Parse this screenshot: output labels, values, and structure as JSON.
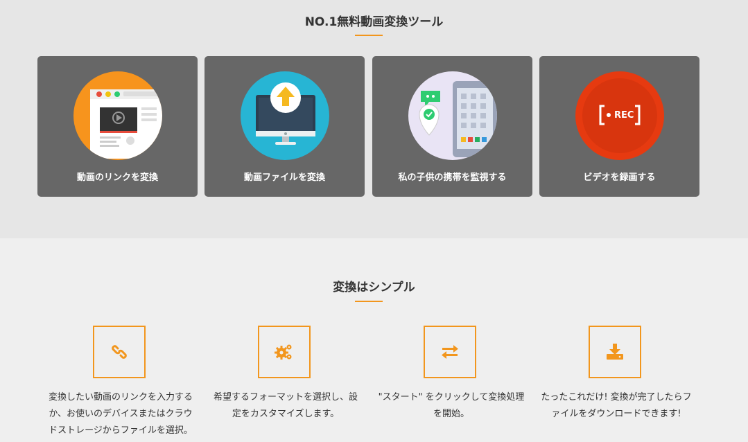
{
  "top_section": {
    "title": "NO.1無料動画変換ツール",
    "cards": [
      {
        "label": "動画のリンクを変換",
        "icon": "browser-video-icon"
      },
      {
        "label": "動画ファイルを変換",
        "icon": "monitor-upload-icon"
      },
      {
        "label": "私の子供の携帯を監視する",
        "icon": "phone-monitor-icon"
      },
      {
        "label": "ビデオを録画する",
        "icon": "rec-icon",
        "rec_text": "REC"
      }
    ]
  },
  "bottom_section": {
    "title": "変換はシンプル",
    "steps": [
      {
        "icon": "link-icon",
        "lines": [
          "変換したい動画のリンクを入力する",
          "か、お使いのデバイスまたはクラウ",
          "ドストレージからファイルを選択。"
        ]
      },
      {
        "icon": "gears-icon",
        "lines": [
          "希望するフォーマットを選択し、設",
          "定をカスタマイズします。"
        ]
      },
      {
        "icon": "swap-arrows-icon",
        "lines": [
          "\"スタート\" をクリックして変換処理",
          "を開始。"
        ]
      },
      {
        "icon": "download-icon",
        "lines": [
          "たったこれだけ! 変換が完了したらフ",
          "ァイルをダウンロードできます!"
        ]
      }
    ]
  },
  "colors": {
    "accent": "#f2961d",
    "card_bg": "#676767",
    "top_bg": "#e6e6e6",
    "bottom_bg": "#efefef"
  }
}
